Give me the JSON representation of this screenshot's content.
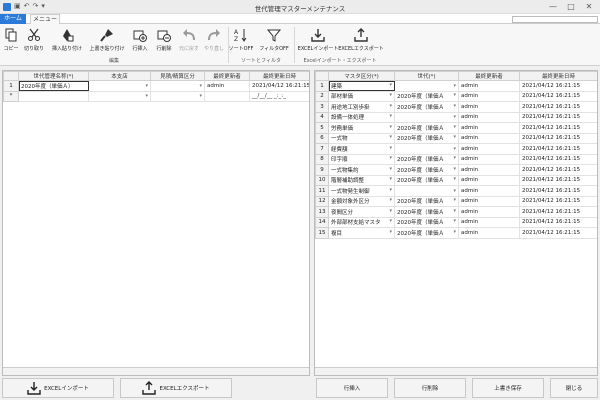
{
  "window": {
    "title": "世代管理マスターメンテナンス",
    "controls": [
      "—",
      "□",
      "✕"
    ]
  },
  "tabs": [
    {
      "label": "ホーム"
    },
    {
      "label": "メニュー"
    }
  ],
  "ribbon": {
    "buttons": [
      {
        "label": "コピー"
      },
      {
        "label": "切り取り"
      },
      {
        "label": "挿入貼り付け"
      },
      {
        "label": "上書き貼り付け"
      },
      {
        "label": "行挿入"
      },
      {
        "label": "行削除"
      },
      {
        "label": "元に戻す"
      },
      {
        "label": "やり直し"
      },
      {
        "label": "ソートOFF"
      },
      {
        "label": "フィルタOFF"
      },
      {
        "label": "EXCELインポート"
      },
      {
        "label": "EXCELエクスポート"
      }
    ],
    "groups": [
      "編集",
      "ソートとフィルタ",
      "Excelインポート・エクスポート"
    ]
  },
  "left": {
    "columns": [
      "世代管理名称(*)",
      "本支店",
      "見積/精算区分",
      "最終更新者",
      "最終更新日時"
    ],
    "rows": [
      {
        "num": "1",
        "name": "2020年度（単価Ａ）",
        "branch": "",
        "kind": "",
        "user": "admin",
        "date": "2021/04/12 16:21:15"
      },
      {
        "num": "*",
        "name": "",
        "branch": "",
        "kind": "",
        "user": "",
        "date": "__/__/__ _:_:_"
      }
    ]
  },
  "right": {
    "columns": [
      "マスタ区分(*)",
      "世代(*)",
      "最終更新者",
      "最終更新日時"
    ],
    "rows": [
      {
        "num": "1",
        "kbn": "建築",
        "gen": "",
        "user": "admin",
        "date": "2021/04/12 16:21:15"
      },
      {
        "num": "2",
        "kbn": "部材単価",
        "gen": "2020年度（単価Ａ",
        "user": "admin",
        "date": "2021/04/12 16:21:15"
      },
      {
        "num": "3",
        "kbn": "用途地工別歩掛",
        "gen": "2020年度（単価Ａ",
        "user": "admin",
        "date": "2021/04/12 16:21:15"
      },
      {
        "num": "4",
        "kbn": "設備一体処理",
        "gen": "",
        "user": "admin",
        "date": "2021/04/12 16:21:15"
      },
      {
        "num": "5",
        "kbn": "労務単価",
        "gen": "2020年度（単価Ａ",
        "user": "admin",
        "date": "2021/04/12 16:21:15"
      },
      {
        "num": "6",
        "kbn": "一式物",
        "gen": "2020年度（単価Ａ",
        "user": "admin",
        "date": "2021/04/12 16:21:15"
      },
      {
        "num": "7",
        "kbn": "経費額",
        "gen": "",
        "user": "admin",
        "date": "2021/04/12 16:21:15"
      },
      {
        "num": "8",
        "kbn": "印字順",
        "gen": "2020年度（単価Ａ",
        "user": "admin",
        "date": "2021/04/12 16:21:15"
      },
      {
        "num": "9",
        "kbn": "一式物集約",
        "gen": "2020年度（単価Ａ",
        "user": "admin",
        "date": "2021/04/12 16:21:15"
      },
      {
        "num": "10",
        "kbn": "階層補助調整",
        "gen": "2020年度（単価Ａ",
        "user": "admin",
        "date": "2021/04/12 16:21:15"
      },
      {
        "num": "11",
        "kbn": "一式物発生制御",
        "gen": "",
        "user": "admin",
        "date": "2021/04/12 16:21:15"
      },
      {
        "num": "12",
        "kbn": "金額対象外区分",
        "gen": "2020年度（単価Ａ",
        "user": "admin",
        "date": "2021/04/12 16:21:15"
      },
      {
        "num": "13",
        "kbn": "夜間区分",
        "gen": "2020年度（単価Ａ",
        "user": "admin",
        "date": "2021/04/12 16:21:15"
      },
      {
        "num": "14",
        "kbn": "外部部材支給マスタ",
        "gen": "2020年度（単価Ａ",
        "user": "admin",
        "date": "2021/04/12 16:21:15"
      },
      {
        "num": "15",
        "kbn": "複目",
        "gen": "2020年度（単価Ａ",
        "user": "admin",
        "date": "2021/04/12 16:21:15"
      }
    ]
  },
  "bottom": {
    "import": "EXCELインポート",
    "export": "EXCELエクスポート",
    "insert": "行挿入",
    "delete": "行削除",
    "save": "上書き保存",
    "close": "閉じる"
  }
}
